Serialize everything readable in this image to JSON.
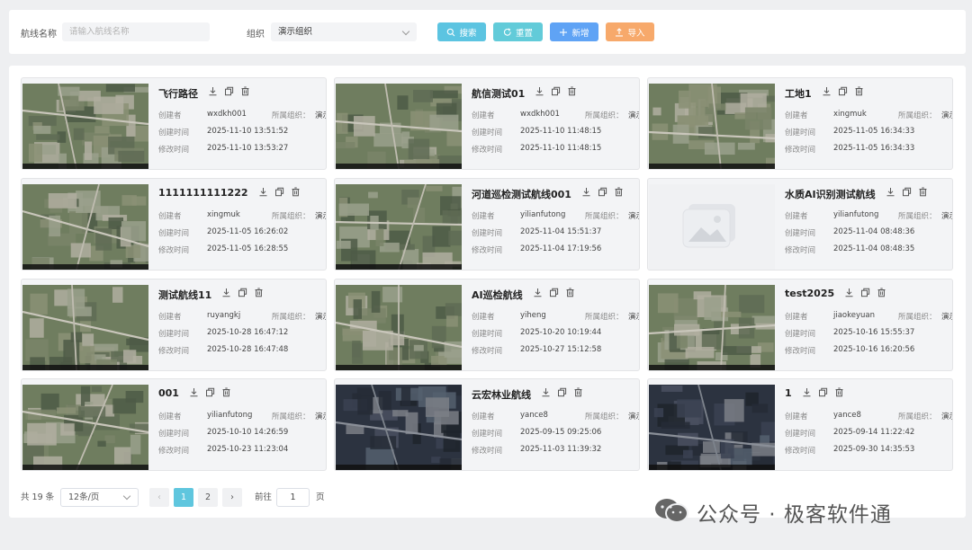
{
  "filter": {
    "name_label": "航线名称",
    "name_placeholder": "请输入航线名称",
    "org_label": "组织",
    "org_value": "演示组织",
    "search_label": "搜索",
    "reset_label": "重置",
    "add_label": "新增",
    "import_label": "导入"
  },
  "colors": {
    "search": "#5cc4e1",
    "reset": "#62cbd9",
    "add": "#5fa3f5",
    "import": "#f7a96b",
    "active_page": "#5fc6de"
  },
  "field_labels": {
    "creator": "创建者",
    "created": "创建时间",
    "modified": "修改时间",
    "org": "所属组织："
  },
  "routes": [
    {
      "name": "飞行路径",
      "creator": "wxdkh001",
      "org": "演示组织",
      "created": "2025-11-10 13:51:52",
      "modified": "2025-11-10 13:53:27",
      "thumb": "satellite"
    },
    {
      "name": "航信测试01",
      "creator": "wxdkh001",
      "org": "演示组织",
      "created": "2025-11-10 11:48:15",
      "modified": "2025-11-10 11:48:15",
      "thumb": "satellite"
    },
    {
      "name": "工地1",
      "creator": "xingmuk",
      "org": "演示组织",
      "created": "2025-11-05 16:34:33",
      "modified": "2025-11-05 16:34:33",
      "thumb": "satellite"
    },
    {
      "name": "1111111111222",
      "creator": "xingmuk",
      "org": "演示组织",
      "created": "2025-11-05 16:26:02",
      "modified": "2025-11-05 16:28:55",
      "thumb": "satellite"
    },
    {
      "name": "河道巡检测试航线001",
      "creator": "yilianfutong",
      "org": "演示组织",
      "created": "2025-11-04 15:51:37",
      "modified": "2025-11-04 17:19:56",
      "thumb": "satellite"
    },
    {
      "name": "水质AI识别测试航线",
      "creator": "yilianfutong",
      "org": "演示组织",
      "created": "2025-11-04 08:48:36",
      "modified": "2025-11-04 08:48:35",
      "thumb": "placeholder"
    },
    {
      "name": "测试航线11",
      "creator": "ruyangkj",
      "org": "演示组织",
      "created": "2025-10-28 16:47:12",
      "modified": "2025-10-28 16:47:48",
      "thumb": "satellite"
    },
    {
      "name": "AI巡检航线",
      "creator": "yiheng",
      "org": "演示组织",
      "created": "2025-10-20 10:19:44",
      "modified": "2025-10-27 15:12:58",
      "thumb": "satellite"
    },
    {
      "name": "test2025",
      "creator": "jiaokeyuan",
      "org": "演示组织",
      "created": "2025-10-16 15:55:37",
      "modified": "2025-10-16 16:20:56",
      "thumb": "satellite"
    },
    {
      "name": "001",
      "creator": "yilianfutong",
      "org": "演示组织",
      "created": "2025-10-10 14:26:59",
      "modified": "2025-10-23 11:23:04",
      "thumb": "satellite"
    },
    {
      "name": "云宏林业航线",
      "creator": "yance8",
      "org": "演示组织",
      "created": "2025-09-15 09:25:06",
      "modified": "2025-11-03 11:39:32",
      "thumb": "dark"
    },
    {
      "name": "1",
      "creator": "yance8",
      "org": "演示组织",
      "created": "2025-09-14 11:22:42",
      "modified": "2025-09-30 14:35:53",
      "thumb": "dark"
    }
  ],
  "pagination": {
    "total_label": "共 19 条",
    "page_size": "12条/页",
    "pages": [
      "1",
      "2"
    ],
    "current_page": 1,
    "goto_label": "前往",
    "goto_value": "1",
    "page_unit": "页"
  },
  "watermark": {
    "text": "公众号 · 极客软件通",
    "icon": "wechat-icon"
  }
}
